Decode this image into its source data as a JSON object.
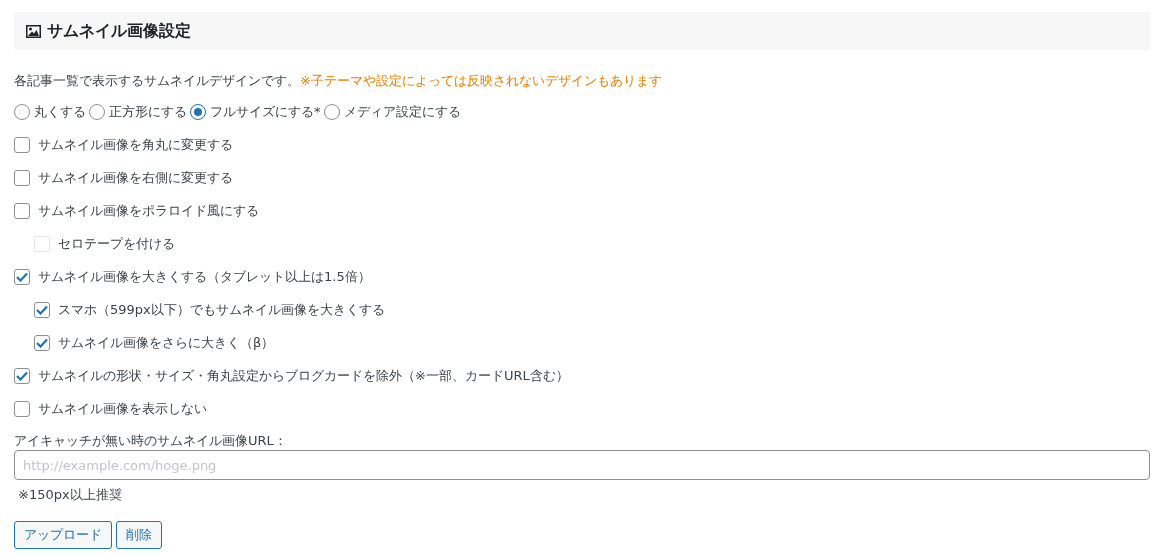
{
  "header": {
    "title": "サムネイル画像設定"
  },
  "description": {
    "text": "各記事一覧で表示するサムネイルデザインです。",
    "note": "※子テーマや設定によっては反映されないデザインもあります"
  },
  "radios": [
    {
      "label": "丸くする",
      "selected": false
    },
    {
      "label": "正方形にする",
      "selected": false
    },
    {
      "label": "フルサイズにする*",
      "selected": true
    },
    {
      "label": "メディア設定にする",
      "selected": false
    }
  ],
  "checkboxes": [
    {
      "label": "サムネイル画像を角丸に変更する",
      "checked": false,
      "disabled": false
    },
    {
      "label": "サムネイル画像を右側に変更する",
      "checked": false,
      "disabled": false
    },
    {
      "label": "サムネイル画像をポラロイド風にする",
      "checked": false,
      "disabled": false,
      "children": [
        {
          "label": "セロテープを付ける",
          "checked": false,
          "disabled": true
        }
      ]
    },
    {
      "label": "サムネイル画像を大きくする（タブレット以上は1.5倍）",
      "checked": true,
      "disabled": false,
      "children": [
        {
          "label": "スマホ（599px以下）でもサムネイル画像を大きくする",
          "checked": true,
          "disabled": false
        },
        {
          "label": "サムネイル画像をさらに大きく（β）",
          "checked": true,
          "disabled": false
        }
      ]
    },
    {
      "label": "サムネイルの形状・サイズ・角丸設定からブログカードを除外（※一部、カードURL含む）",
      "checked": true,
      "disabled": false
    },
    {
      "label": "サムネイル画像を表示しない",
      "checked": false,
      "disabled": false
    }
  ],
  "url_field": {
    "label": "アイキャッチが無い時のサムネイル画像URL：",
    "placeholder": "http://example.com/hoge.png",
    "note": "※150px以上推奨"
  },
  "buttons": [
    "アップロード",
    "削除"
  ]
}
